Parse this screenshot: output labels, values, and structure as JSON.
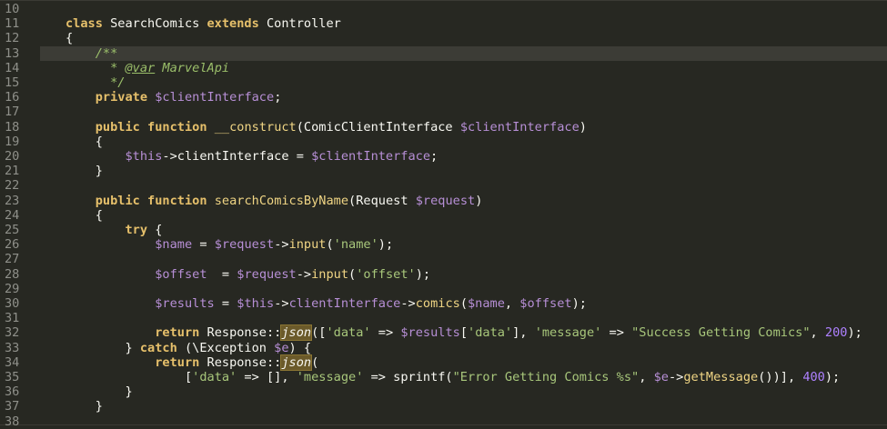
{
  "editor": {
    "language": "php",
    "active_line": 13,
    "lines": [
      {
        "n": "10",
        "tokens": []
      },
      {
        "n": "11",
        "tokens": [
          [
            "kw",
            "class"
          ],
          [
            "plain",
            " SearchComics "
          ],
          [
            "kw",
            "extends"
          ],
          [
            "plain",
            " Controller"
          ]
        ]
      },
      {
        "n": "12",
        "tokens": [
          [
            "plain",
            "{"
          ]
        ]
      },
      {
        "n": "13",
        "tokens": [
          [
            "plain",
            "    "
          ],
          [
            "cmt",
            "/**"
          ]
        ]
      },
      {
        "n": "14",
        "tokens": [
          [
            "plain",
            "    "
          ],
          [
            "cmt",
            "  * "
          ],
          [
            "tag",
            "@var"
          ],
          [
            "cmt",
            " MarvelApi"
          ]
        ]
      },
      {
        "n": "15",
        "tokens": [
          [
            "plain",
            "    "
          ],
          [
            "cmt",
            "  */"
          ]
        ]
      },
      {
        "n": "16",
        "tokens": [
          [
            "plain",
            "    "
          ],
          [
            "kw",
            "private"
          ],
          [
            "plain",
            " "
          ],
          [
            "var",
            "$clientInterface"
          ],
          [
            "plain",
            ";"
          ]
        ]
      },
      {
        "n": "17",
        "tokens": []
      },
      {
        "n": "18",
        "tokens": [
          [
            "plain",
            "    "
          ],
          [
            "kw",
            "public"
          ],
          [
            "plain",
            " "
          ],
          [
            "kw",
            "function"
          ],
          [
            "plain",
            " "
          ],
          [
            "func",
            "__construct"
          ],
          [
            "plain",
            "(ComicClientInterface "
          ],
          [
            "var",
            "$clientInterface"
          ],
          [
            "plain",
            ")"
          ]
        ]
      },
      {
        "n": "19",
        "tokens": [
          [
            "plain",
            "    {"
          ]
        ]
      },
      {
        "n": "20",
        "tokens": [
          [
            "plain",
            "        "
          ],
          [
            "var",
            "$this"
          ],
          [
            "plain",
            "->clientInterface = "
          ],
          [
            "var",
            "$clientInterface"
          ],
          [
            "plain",
            ";"
          ]
        ]
      },
      {
        "n": "21",
        "tokens": [
          [
            "plain",
            "    }"
          ]
        ]
      },
      {
        "n": "22",
        "tokens": []
      },
      {
        "n": "23",
        "tokens": [
          [
            "plain",
            "    "
          ],
          [
            "kw",
            "public"
          ],
          [
            "plain",
            " "
          ],
          [
            "kw",
            "function"
          ],
          [
            "plain",
            " "
          ],
          [
            "func",
            "searchComicsByName"
          ],
          [
            "plain",
            "(Request "
          ],
          [
            "var",
            "$request"
          ],
          [
            "plain",
            ")"
          ]
        ]
      },
      {
        "n": "24",
        "tokens": [
          [
            "plain",
            "    {"
          ]
        ]
      },
      {
        "n": "25",
        "tokens": [
          [
            "plain",
            "        "
          ],
          [
            "kw",
            "try"
          ],
          [
            "plain",
            " {"
          ]
        ]
      },
      {
        "n": "26",
        "tokens": [
          [
            "plain",
            "            "
          ],
          [
            "var",
            "$name"
          ],
          [
            "plain",
            " = "
          ],
          [
            "var",
            "$request"
          ],
          [
            "plain",
            "->"
          ],
          [
            "func",
            "input"
          ],
          [
            "plain",
            "("
          ],
          [
            "str",
            "'name'"
          ],
          [
            "plain",
            ");"
          ]
        ]
      },
      {
        "n": "27",
        "tokens": []
      },
      {
        "n": "28",
        "tokens": [
          [
            "plain",
            "            "
          ],
          [
            "var",
            "$offset"
          ],
          [
            "plain",
            "  = "
          ],
          [
            "var",
            "$request"
          ],
          [
            "plain",
            "->"
          ],
          [
            "func",
            "input"
          ],
          [
            "plain",
            "("
          ],
          [
            "str",
            "'offset'"
          ],
          [
            "plain",
            ");"
          ]
        ]
      },
      {
        "n": "29",
        "tokens": []
      },
      {
        "n": "30",
        "tokens": [
          [
            "plain",
            "            "
          ],
          [
            "var",
            "$results"
          ],
          [
            "plain",
            " = "
          ],
          [
            "var",
            "$this"
          ],
          [
            "plain",
            "->"
          ],
          [
            "var",
            "clientInterface"
          ],
          [
            "plain",
            "->"
          ],
          [
            "func",
            "comics"
          ],
          [
            "plain",
            "("
          ],
          [
            "var",
            "$name"
          ],
          [
            "plain",
            ", "
          ],
          [
            "var",
            "$offset"
          ],
          [
            "plain",
            ");"
          ]
        ]
      },
      {
        "n": "31",
        "tokens": []
      },
      {
        "n": "32",
        "tokens": [
          [
            "plain",
            "            "
          ],
          [
            "kw",
            "return"
          ],
          [
            "plain",
            " Response::"
          ],
          [
            "hl",
            "json"
          ],
          [
            "plain",
            "(["
          ],
          [
            "str",
            "'data'"
          ],
          [
            "plain",
            " => "
          ],
          [
            "var",
            "$results"
          ],
          [
            "plain",
            "["
          ],
          [
            "str",
            "'data'"
          ],
          [
            "plain",
            "], "
          ],
          [
            "str",
            "'message'"
          ],
          [
            "plain",
            " => "
          ],
          [
            "str",
            "\"Success Getting Comics\""
          ],
          [
            "plain",
            ", "
          ],
          [
            "num",
            "200"
          ],
          [
            "plain",
            ");"
          ]
        ]
      },
      {
        "n": "33",
        "tokens": [
          [
            "plain",
            "        } "
          ],
          [
            "kw",
            "catch"
          ],
          [
            "plain",
            " (\\Exception "
          ],
          [
            "var",
            "$e"
          ],
          [
            "plain",
            ") {"
          ]
        ]
      },
      {
        "n": "34",
        "tokens": [
          [
            "plain",
            "            "
          ],
          [
            "kw",
            "return"
          ],
          [
            "plain",
            " Response::"
          ],
          [
            "hl",
            "json"
          ],
          [
            "plain",
            "("
          ]
        ]
      },
      {
        "n": "35",
        "tokens": [
          [
            "plain",
            "                ["
          ],
          [
            "str",
            "'data'"
          ],
          [
            "plain",
            " => [], "
          ],
          [
            "str",
            "'message'"
          ],
          [
            "plain",
            " => sprintf("
          ],
          [
            "str",
            "\"Error Getting Comics %s\""
          ],
          [
            "plain",
            ", "
          ],
          [
            "var",
            "$e"
          ],
          [
            "plain",
            "->"
          ],
          [
            "func",
            "getMessage"
          ],
          [
            "plain",
            "())], "
          ],
          [
            "num",
            "400"
          ],
          [
            "plain",
            ");"
          ]
        ]
      },
      {
        "n": "36",
        "tokens": [
          [
            "plain",
            "        }"
          ]
        ]
      },
      {
        "n": "37",
        "tokens": [
          [
            "plain",
            "    }"
          ]
        ]
      },
      {
        "n": "38",
        "tokens": []
      }
    ]
  }
}
